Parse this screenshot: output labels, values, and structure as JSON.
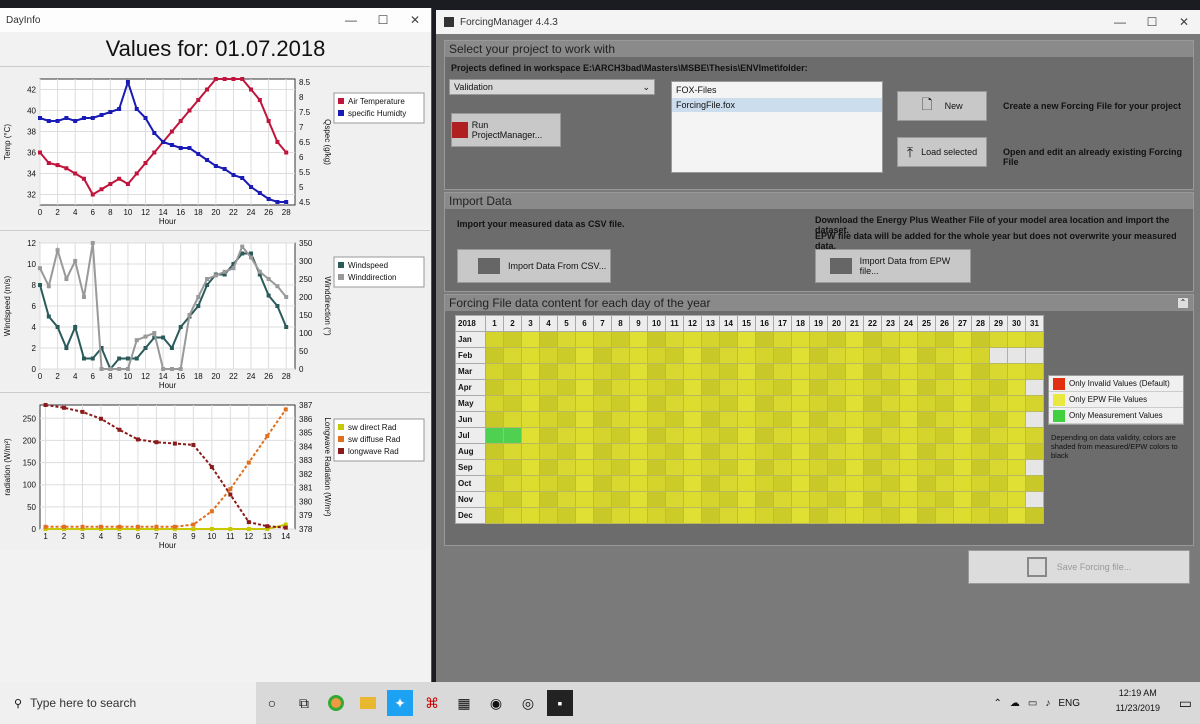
{
  "dayinfo": {
    "title": "DayInfo",
    "heading": "Values for: 01.07.2018"
  },
  "chart_data": [
    {
      "type": "line",
      "xlabel": "Hour",
      "ylabel": "Temp (°C)",
      "y2label": "Qspec (g/kg)",
      "xticks": [
        "0",
        "2",
        "4",
        "6",
        "8",
        "10",
        "12",
        "14",
        "16",
        "18",
        "20",
        "22",
        "24",
        "26",
        "28"
      ],
      "yticks": [
        "32",
        "34",
        "36",
        "38",
        "40",
        "42"
      ],
      "y2ticks": [
        "4.5",
        "5",
        "5.5",
        "6",
        "6.5",
        "7",
        "7.5",
        "8",
        "8.5"
      ],
      "ylim": [
        31,
        43
      ],
      "y2lim": [
        4.4,
        8.6
      ],
      "xlim": [
        0,
        29
      ],
      "series": [
        {
          "name": "Air Temperature",
          "axis": "left",
          "color": "#c0143c",
          "x": [
            0,
            1,
            2,
            3,
            4,
            5,
            6,
            7,
            8,
            9,
            10,
            11,
            12,
            13,
            14,
            15,
            16,
            17,
            18,
            19,
            20,
            21,
            22,
            23,
            24,
            25,
            26,
            27,
            28
          ],
          "values": [
            36,
            35,
            34.8,
            34.5,
            34,
            33.5,
            32,
            32.5,
            33,
            33.5,
            33,
            34,
            35,
            36,
            37,
            38,
            39,
            40,
            41,
            42,
            43,
            43,
            43,
            43,
            42,
            41,
            39,
            37,
            36
          ]
        },
        {
          "name": "specific Humidty",
          "axis": "right",
          "color": "#1a1ab4",
          "x": [
            0,
            1,
            2,
            3,
            4,
            5,
            6,
            7,
            8,
            9,
            10,
            11,
            12,
            13,
            14,
            15,
            16,
            17,
            18,
            19,
            20,
            21,
            22,
            23,
            24,
            25,
            26,
            27,
            28
          ],
          "values": [
            7.3,
            7.2,
            7.2,
            7.3,
            7.2,
            7.3,
            7.3,
            7.4,
            7.5,
            7.6,
            8.5,
            7.6,
            7.3,
            6.8,
            6.5,
            6.4,
            6.3,
            6.3,
            6.1,
            5.9,
            5.7,
            5.6,
            5.4,
            5.3,
            5.0,
            4.8,
            4.6,
            4.5,
            4.5
          ]
        }
      ]
    },
    {
      "type": "line",
      "xlabel": "Hour",
      "ylabel": "Windspeed (m/s)",
      "y2label": "Winddirection (°)",
      "xticks": [
        "0",
        "2",
        "4",
        "6",
        "8",
        "10",
        "12",
        "14",
        "16",
        "18",
        "20",
        "22",
        "24",
        "26",
        "28"
      ],
      "yticks": [
        "0",
        "2",
        "4",
        "6",
        "8",
        "10",
        "12"
      ],
      "y2ticks": [
        "0",
        "50",
        "100",
        "150",
        "200",
        "250",
        "300",
        "350"
      ],
      "ylim": [
        0,
        12
      ],
      "y2lim": [
        0,
        350
      ],
      "xlim": [
        0,
        29
      ],
      "series": [
        {
          "name": "Windspeed",
          "axis": "left",
          "color": "#2a5a5a",
          "x": [
            0,
            1,
            2,
            3,
            4,
            5,
            6,
            7,
            8,
            9,
            10,
            11,
            12,
            13,
            14,
            15,
            16,
            17,
            18,
            19,
            20,
            21,
            22,
            23,
            24,
            25,
            26,
            27,
            28
          ],
          "values": [
            8,
            5,
            4,
            2,
            4,
            1,
            1,
            2,
            0,
            1,
            1,
            1,
            2,
            3,
            3,
            2,
            4,
            5,
            6,
            8,
            9,
            9,
            10,
            11,
            11,
            9,
            7,
            6,
            4
          ]
        },
        {
          "name": "Winddirection",
          "axis": "right",
          "color": "#999999",
          "x": [
            0,
            1,
            2,
            3,
            4,
            5,
            6,
            7,
            8,
            9,
            10,
            11,
            12,
            13,
            14,
            15,
            16,
            17,
            18,
            19,
            20,
            21,
            22,
            23,
            24,
            25,
            26,
            27,
            28
          ],
          "values": [
            280,
            230,
            330,
            250,
            300,
            200,
            350,
            0,
            0,
            0,
            0,
            80,
            90,
            100,
            0,
            0,
            0,
            150,
            200,
            250,
            260,
            270,
            280,
            340,
            310,
            270,
            250,
            230,
            200
          ]
        }
      ]
    },
    {
      "type": "line",
      "xlabel": "Hour",
      "ylabel": "radiation (W/m²)",
      "y2label": "Longwave Radiation (W/m²)",
      "xticks": [
        "1",
        "2",
        "3",
        "4",
        "5",
        "6",
        "7",
        "8",
        "9",
        "10",
        "11",
        "12",
        "13",
        "14"
      ],
      "yticks": [
        "0",
        "50",
        "100",
        "150",
        "200",
        "250"
      ],
      "y2ticks": [
        "378",
        "379",
        "380",
        "381",
        "382",
        "383",
        "384",
        "385",
        "386",
        "387"
      ],
      "ylim": [
        0,
        280
      ],
      "y2lim": [
        378,
        387
      ],
      "xlim": [
        0.7,
        14.5
      ],
      "series": [
        {
          "name": "sw direct Rad",
          "axis": "left",
          "color": "#c8c800",
          "x": [
            1,
            2,
            3,
            4,
            5,
            6,
            7,
            8,
            9,
            10,
            11,
            12,
            13,
            14
          ],
          "values": [
            0,
            0,
            0,
            0,
            0,
            0,
            0,
            0,
            0,
            0,
            0,
            0,
            0,
            10
          ]
        },
        {
          "name": "sw diffuse Rad",
          "axis": "left",
          "color": "#e07020",
          "x": [
            1,
            2,
            3,
            4,
            5,
            6,
            7,
            8,
            9,
            10,
            11,
            12,
            13,
            14
          ],
          "values": [
            5,
            5,
            5,
            5,
            5,
            5,
            5,
            5,
            10,
            40,
            90,
            150,
            210,
            270
          ]
        },
        {
          "name": "longwave Rad",
          "axis": "right",
          "color": "#8b1a1a",
          "x": [
            1,
            2,
            3,
            4,
            5,
            6,
            7,
            8,
            9,
            10,
            11,
            12,
            13,
            14
          ],
          "values": [
            387,
            386.8,
            386.5,
            386,
            385.2,
            384.5,
            384.3,
            384.2,
            384.1,
            382.5,
            380.5,
            378.5,
            378.2,
            378.1
          ]
        }
      ]
    }
  ],
  "fm": {
    "title": "ForcingManager 4.4.3",
    "select_header": "Select your project to work with",
    "workspace_label": "Projects defined in workspace E:\\ARCH3bad\\Masters\\MSBE\\Thesis\\ENVImet\\folder:",
    "project_value": "Validation",
    "run_pm": "Run ProjectManager...",
    "files": [
      "FOX-Files",
      "ForcingFile.fox"
    ],
    "new_btn": "New",
    "new_desc": "Create a new Forcing File for your project",
    "load_btn": "Load selected",
    "load_desc": "Open and edit an already existing Forcing File",
    "import_header": "Import Data",
    "import_csv_desc": "Import your measured data as CSV file.",
    "epw_desc1": "Download the Energy Plus Weather File of your model area location and import the dataset.",
    "epw_desc2": "EPW file data will be added for the whole year but does not overwrite your measured data.",
    "import_csv_btn": "Import Data From CSV...",
    "import_epw_btn": "Import Data from EPW file...",
    "content_header": "Forcing File data content for each day of the year",
    "year": "2018",
    "months": [
      "Jan",
      "Feb",
      "Mar",
      "Apr",
      "May",
      "Jun",
      "Jul",
      "Aug",
      "Sep",
      "Oct",
      "Nov",
      "Dec"
    ],
    "legend": [
      {
        "label": "Only Invalid Values (Default)",
        "color": "#e03010"
      },
      {
        "label": "Only EPW File Values",
        "color": "#e8e840"
      },
      {
        "label": "Only Measurement Values",
        "color": "#40d040"
      }
    ],
    "legend_note": "Depending on data validity, colors are shaded from measured/EPW colors to black",
    "save_btn": "Save Forcing file..."
  },
  "taskbar": {
    "search": "Type here to search",
    "time": "12:19 AM",
    "date": "11/23/2019",
    "lang": "ENG"
  }
}
